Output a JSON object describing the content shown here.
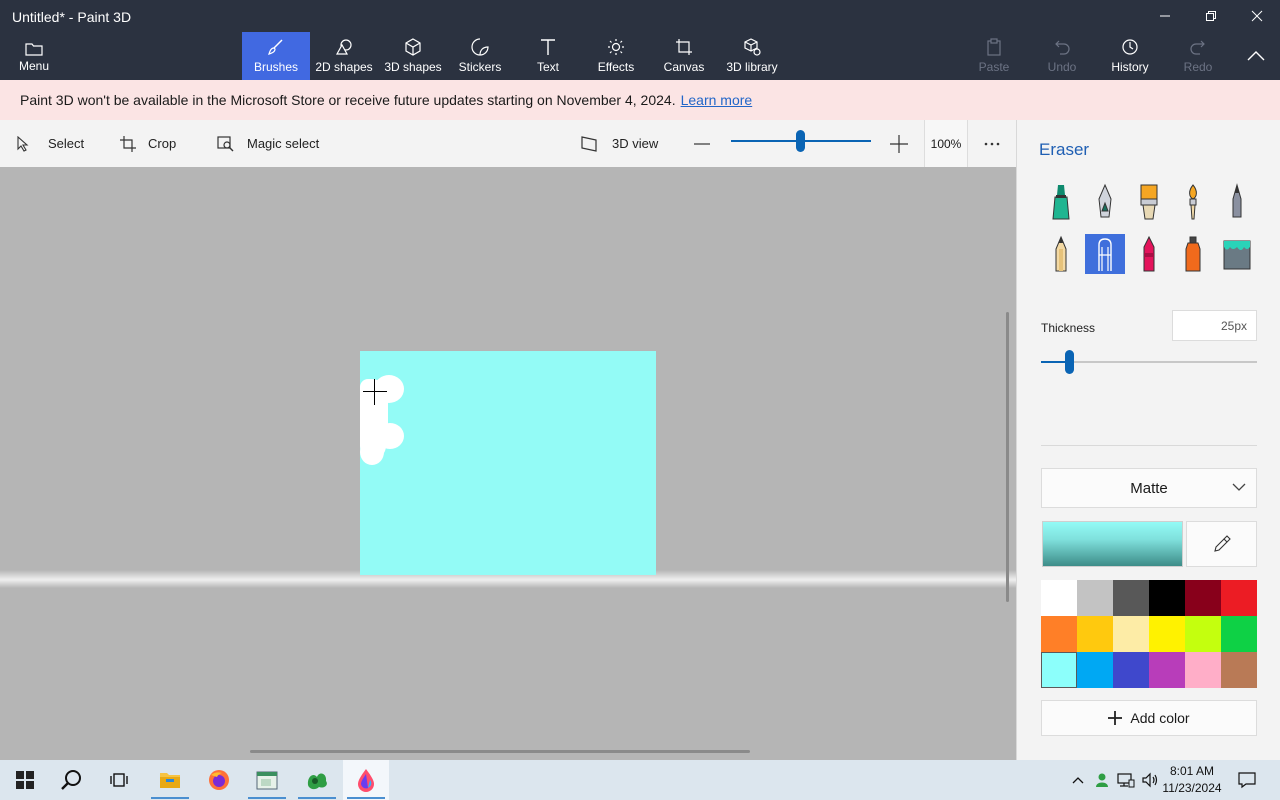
{
  "window": {
    "title": "Untitled* - Paint 3D"
  },
  "ribbon": {
    "menu": "Menu",
    "tools": [
      {
        "label": "Brushes",
        "icon": "brush-icon",
        "active": true
      },
      {
        "label": "2D shapes",
        "icon": "2d-shapes-icon"
      },
      {
        "label": "3D shapes",
        "icon": "3d-shapes-icon"
      },
      {
        "label": "Stickers",
        "icon": "stickers-icon"
      },
      {
        "label": "Text",
        "icon": "text-icon"
      },
      {
        "label": "Effects",
        "icon": "effects-icon"
      },
      {
        "label": "Canvas",
        "icon": "canvas-icon"
      },
      {
        "label": "3D library",
        "icon": "3d-library-icon"
      }
    ],
    "actions": [
      {
        "label": "Paste",
        "disabled": true
      },
      {
        "label": "Undo",
        "disabled": true
      },
      {
        "label": "History",
        "disabled": false
      },
      {
        "label": "Redo",
        "disabled": true
      }
    ]
  },
  "banner": {
    "message": "Paint 3D won't be available in the Microsoft Store or receive future updates starting on November 4, 2024.",
    "link": "Learn more"
  },
  "toolbar": {
    "select": "Select",
    "crop": "Crop",
    "magic_select": "Magic select",
    "view_3d": "3D view",
    "zoom_percent": "100%",
    "zoom_level": 0.46
  },
  "panel": {
    "title": "Eraser",
    "brushes": [
      "marker",
      "calligraphy-pen",
      "oil-brush",
      "watercolor",
      "pixel-pen",
      "pencil",
      "eraser",
      "crayon",
      "spray-can",
      "fill"
    ],
    "selected_brush": "eraser",
    "thickness_label": "Thickness",
    "thickness_value": "25px",
    "thickness_level": 0.13,
    "finish": "Matte",
    "current_color": "#93fbf6",
    "palette": [
      "#ffffff",
      "#c3c3c3",
      "#585858",
      "#000000",
      "#88001b",
      "#ec1c24",
      "#ff7f27",
      "#ffc90e",
      "#fdeca6",
      "#fff200",
      "#c4ff0e",
      "#0ed145",
      "#8cfffb",
      "#00a8f3",
      "#3f48cc",
      "#b83dba",
      "#ffaec8",
      "#b97a56"
    ],
    "add_color": "Add color"
  },
  "taskbar": {
    "apps": [
      "start-icon",
      "search-icon",
      "task-view-icon",
      "file-explorer-icon",
      "firefox-icon",
      "notepad-icon",
      "app-icon",
      "paint-3d-icon"
    ],
    "time": "8:01 AM",
    "date": "11/23/2024"
  }
}
